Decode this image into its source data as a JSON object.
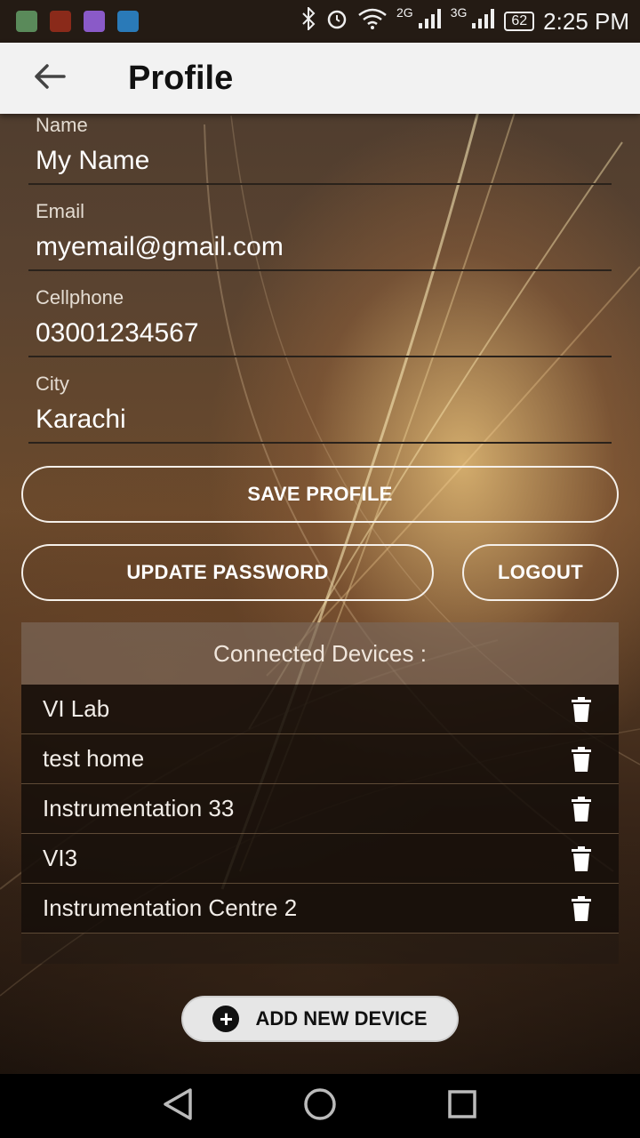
{
  "status_bar": {
    "time": "2:25 PM",
    "battery": "62",
    "network_1": "2G",
    "network_2": "3G"
  },
  "toolbar": {
    "title": "Profile"
  },
  "form": {
    "name_label": "Name",
    "name_value": "My Name",
    "email_label": "Email",
    "email_value": "myemail@gmail.com",
    "cellphone_label": "Cellphone",
    "cellphone_value": "03001234567",
    "city_label": "City",
    "city_value": "Karachi"
  },
  "buttons": {
    "save_profile": "SAVE PROFILE",
    "update_password": "UPDATE PASSWORD",
    "logout": "LOGOUT",
    "add_new_device": "ADD NEW DEVICE"
  },
  "devices": {
    "header": "Connected Devices :",
    "items": [
      {
        "name": "VI Lab"
      },
      {
        "name": "test home"
      },
      {
        "name": "Instrumentation 33"
      },
      {
        "name": "VI3"
      },
      {
        "name": "Instrumentation Centre 2"
      }
    ]
  },
  "icons": {
    "back": "arrow-left-icon",
    "trash": "trash-icon",
    "add": "plus-circle-icon",
    "nav_back": "triangle-back-icon",
    "nav_home": "circle-home-icon",
    "nav_recents": "square-recents-icon"
  },
  "colors": {
    "toolbar": "#f2f2f2",
    "status_bar": "#241b14",
    "accent_outline": "#f5f0ea"
  }
}
